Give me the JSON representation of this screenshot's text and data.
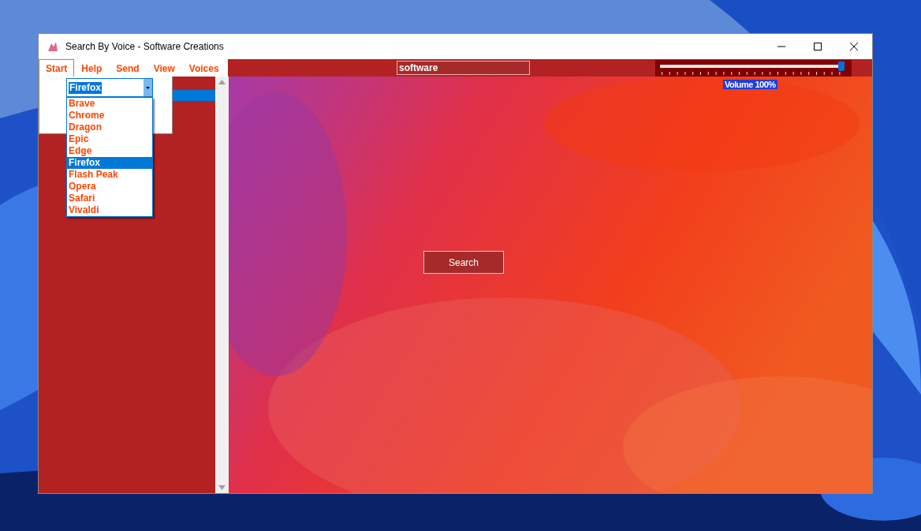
{
  "window": {
    "title": "Search By Voice - Software Creations"
  },
  "menu": [
    {
      "label": "Start",
      "selected": true
    },
    {
      "label": "Help",
      "selected": false
    },
    {
      "label": "Send",
      "selected": false
    },
    {
      "label": "View",
      "selected": false
    },
    {
      "label": "Voices",
      "selected": false
    }
  ],
  "browser_combo": {
    "value": "Firefox",
    "expanded": true,
    "options": [
      {
        "label": "Brave",
        "selected": false
      },
      {
        "label": "Chrome",
        "selected": false
      },
      {
        "label": "Dragon",
        "selected": false
      },
      {
        "label": "Epic",
        "selected": false
      },
      {
        "label": "Edge",
        "selected": false
      },
      {
        "label": "Firefox",
        "selected": true
      },
      {
        "label": "Flash Peak",
        "selected": false
      },
      {
        "label": "Opera",
        "selected": false
      },
      {
        "label": "Safari",
        "selected": false
      },
      {
        "label": "Vivaldi",
        "selected": false
      }
    ]
  },
  "search_field": {
    "value": "software"
  },
  "volume": {
    "level": 1,
    "reading": "Volume 100%"
  },
  "search_button": "Search"
}
